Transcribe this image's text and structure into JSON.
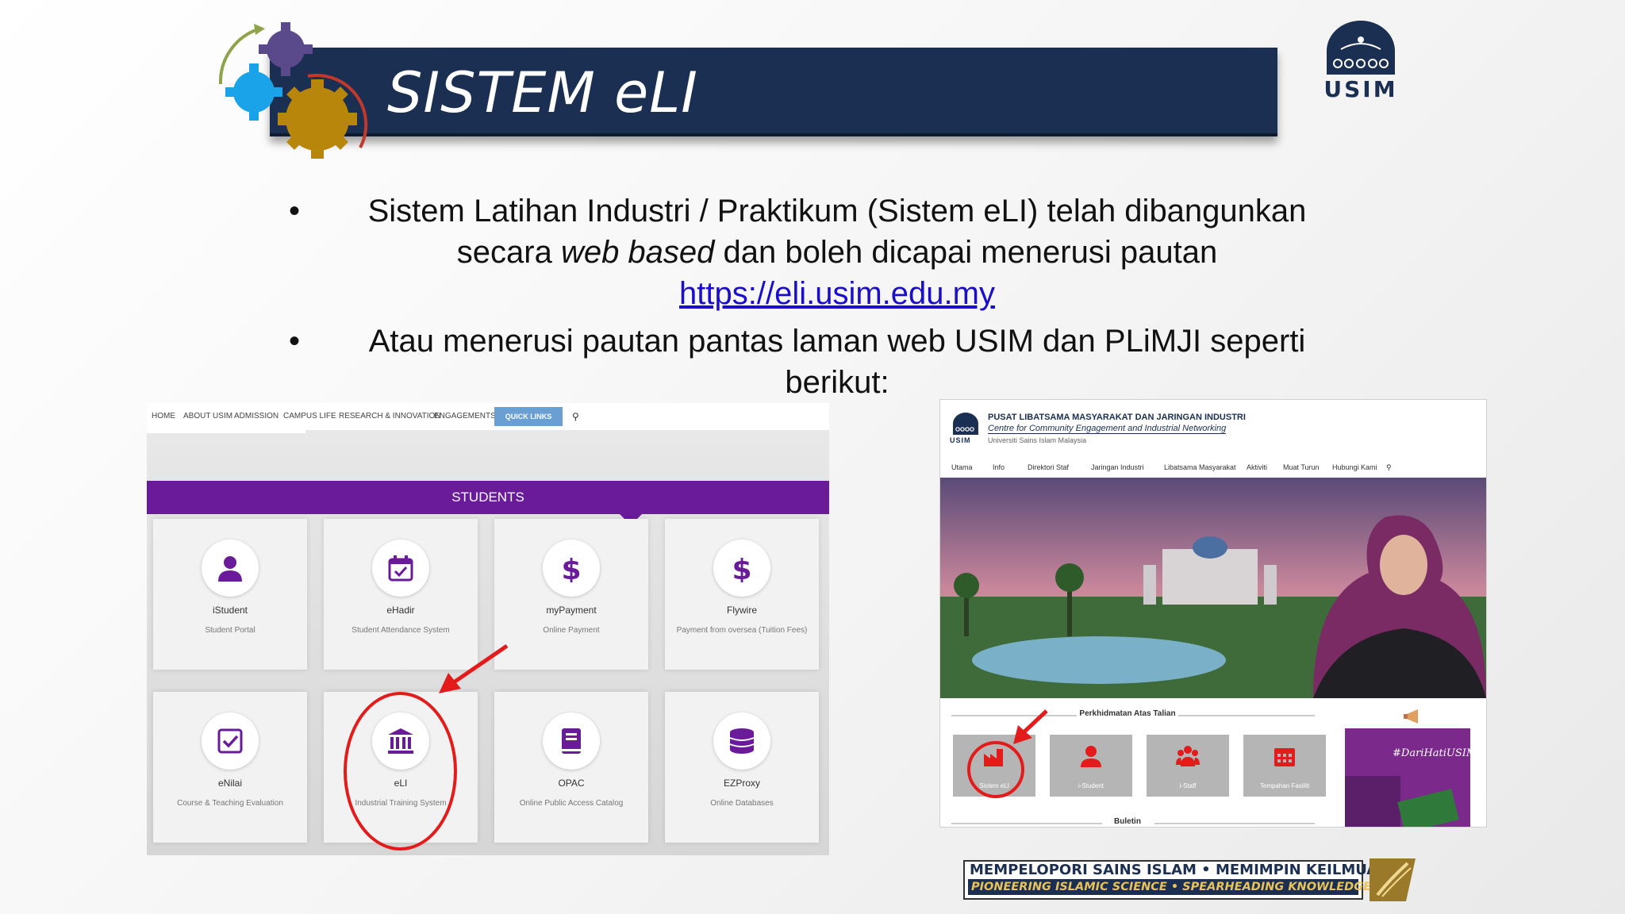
{
  "slide": {
    "title": "SISTEM eLI",
    "logo_text": "USIM",
    "bullets": {
      "b1_line1": "Sistem Latihan Industri / Praktikum (Sistem eLI) telah dibangunkan",
      "b1_line2_pre": "secara ",
      "b1_line2_em": "web based",
      "b1_line2_post": " dan boleh dicapai menerusi pautan",
      "b1_link": "https://eli.usim.edu.my",
      "b2_line1": "Atau menerusi pautan pantas laman web USIM dan PLiMJI seperti",
      "b2_line2": "berikut:"
    },
    "slogan_top": "MEMPELOPORI SAINS ISLAM • MEMIMPIN KEILMUAN",
    "slogan_bottom": "PIONEERING ISLAMIC SCIENCE • SPEARHEADING KNOWLEDGE"
  },
  "left_shot": {
    "nav": [
      "HOME",
      "ABOUT USIM",
      "ADMISSION",
      "CAMPUS LIFE",
      "RESEARCH & INNOVATION",
      "ENGAGEMENTS"
    ],
    "quick_links": "QUICK LINKS",
    "section_title": "STUDENTS",
    "cards": [
      {
        "title": "iStudent",
        "sub": "Student Portal",
        "icon": "user-icon"
      },
      {
        "title": "eHadir",
        "sub": "Student Attendance System",
        "icon": "calendar-check-icon"
      },
      {
        "title": "myPayment",
        "sub": "Online Payment",
        "icon": "dollar-icon"
      },
      {
        "title": "Flywire",
        "sub": "Payment from oversea (Tuition Fees)",
        "icon": "dollar-icon"
      },
      {
        "title": "eNilai",
        "sub": "Course & Teaching Evaluation",
        "icon": "checkbox-icon"
      },
      {
        "title": "eLI",
        "sub": "Industrial Training System",
        "icon": "institution-icon"
      },
      {
        "title": "OPAC",
        "sub": "Online Public Access Catalog",
        "icon": "book-icon"
      },
      {
        "title": "EZProxy",
        "sub": "Online Databases",
        "icon": "database-icon"
      }
    ]
  },
  "right_shot": {
    "header_title": "PUSAT LIBATSAMA MASYARAKAT DAN JARINGAN INDUSTRI",
    "header_subtitle": "Centre for Community Engagement and Industrial Networking",
    "header_logo_text": "USIM",
    "header_university": "Universiti Sains Islam Malaysia",
    "nav": [
      "Utama",
      "Info",
      "Direktori Staf",
      "Jaringan Industri",
      "Libatsama Masyarakat",
      "Aktiviti",
      "Muat Turun",
      "Hubungi Kami"
    ],
    "services_title": "Perkhidmatan Atas Talian",
    "services": [
      "Sistem eLI",
      "i-Student",
      "i-Staff",
      "Tempahan Fasiliti"
    ],
    "buletin": "Buletin",
    "promo_text": "#DariHatiUSIM",
    "colors": {
      "tile": "#b5b5b5",
      "promo": "#7b2a8c",
      "highlight": "#e41b1b"
    }
  }
}
